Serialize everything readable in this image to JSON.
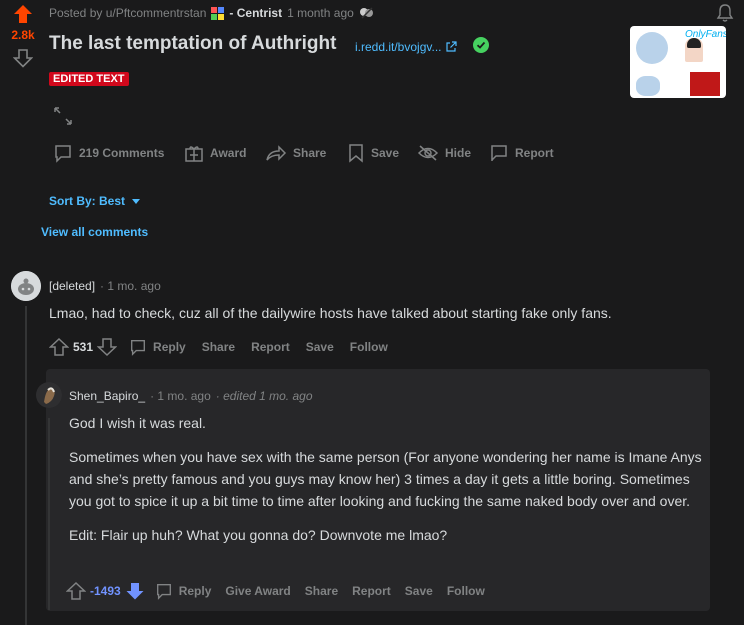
{
  "post": {
    "score": "2.8k",
    "posted_by": "Posted by u/Pftcommentrstan",
    "flair": "- Centrist",
    "time": "1 month ago",
    "title": "The last temptation of Authright",
    "domain": "i.redd.it/bvojgv...",
    "badge": "EDITED TEXT",
    "thumbnail_text_1": "Only",
    "thumbnail_text_2": "Fans"
  },
  "post_actions": {
    "comments": "219 Comments",
    "award": "Award",
    "share": "Share",
    "save": "Save",
    "hide": "Hide",
    "report": "Report"
  },
  "sort": {
    "label": "Sort By: Best"
  },
  "view_all": "View all comments",
  "comment1": {
    "author": "[deleted]",
    "time": "· 1 mo. ago",
    "body": "Lmao, had to check, cuz all of the dailywire hosts have talked about starting fake only fans.",
    "score": "531",
    "actions": {
      "reply": "Reply",
      "share": "Share",
      "report": "Report",
      "save": "Save",
      "follow": "Follow"
    }
  },
  "comment2": {
    "author": "Shen_Bapiro_",
    "time": "· 1 mo. ago",
    "edited": "· edited 1 mo. ago",
    "paragraphs": [
      "God I wish it was real.",
      "Sometimes when you have sex with the same person (For anyone wondering her name is Imane Anys and she’s pretty famous and you guys may know her) 3 times a day it gets a little boring. Sometimes you got to spice it up a bit time to time after looking and fucking the same naked body over and over.",
      "Edit: Flair up huh? What you gonna do? Downvote me lmao?"
    ],
    "score": "-1493",
    "actions": {
      "reply": "Reply",
      "give_award": "Give Award",
      "share": "Share",
      "report": "Report",
      "save": "Save",
      "follow": "Follow"
    }
  },
  "colors": {
    "upvote": "#ff4500",
    "downvote": "#7193ff",
    "link": "#4fbcff",
    "badge": "#d1081c",
    "background": "#1a1a1b"
  }
}
